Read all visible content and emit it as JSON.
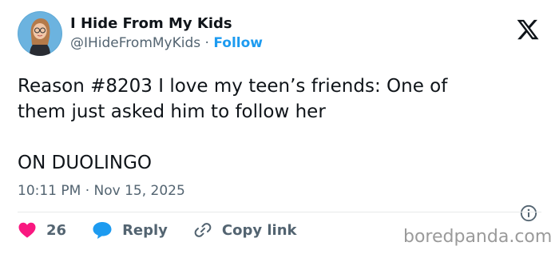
{
  "author": {
    "display_name": "I Hide From My Kids",
    "handle": "@IHideFromMyKids",
    "separator": "·",
    "follow_label": "Follow"
  },
  "tweet": {
    "line1": "Reason #8203 I love my teen’s friends: One of",
    "line2": "them just asked him to follow her",
    "line3": "ON DUOLINGO",
    "timestamp": "10:11 PM · Nov 15, 2025"
  },
  "actions": {
    "like_count": "26",
    "reply_label": "Reply",
    "copy_label": "Copy link"
  },
  "watermark": "boredpanda.com",
  "colors": {
    "accent": "#1d9bf0",
    "like": "#f91880",
    "text": "#0f1419",
    "secondary": "#536471"
  },
  "icons": [
    "x-logo-icon",
    "info-icon",
    "heart-icon",
    "reply-bubble-icon",
    "link-icon"
  ]
}
